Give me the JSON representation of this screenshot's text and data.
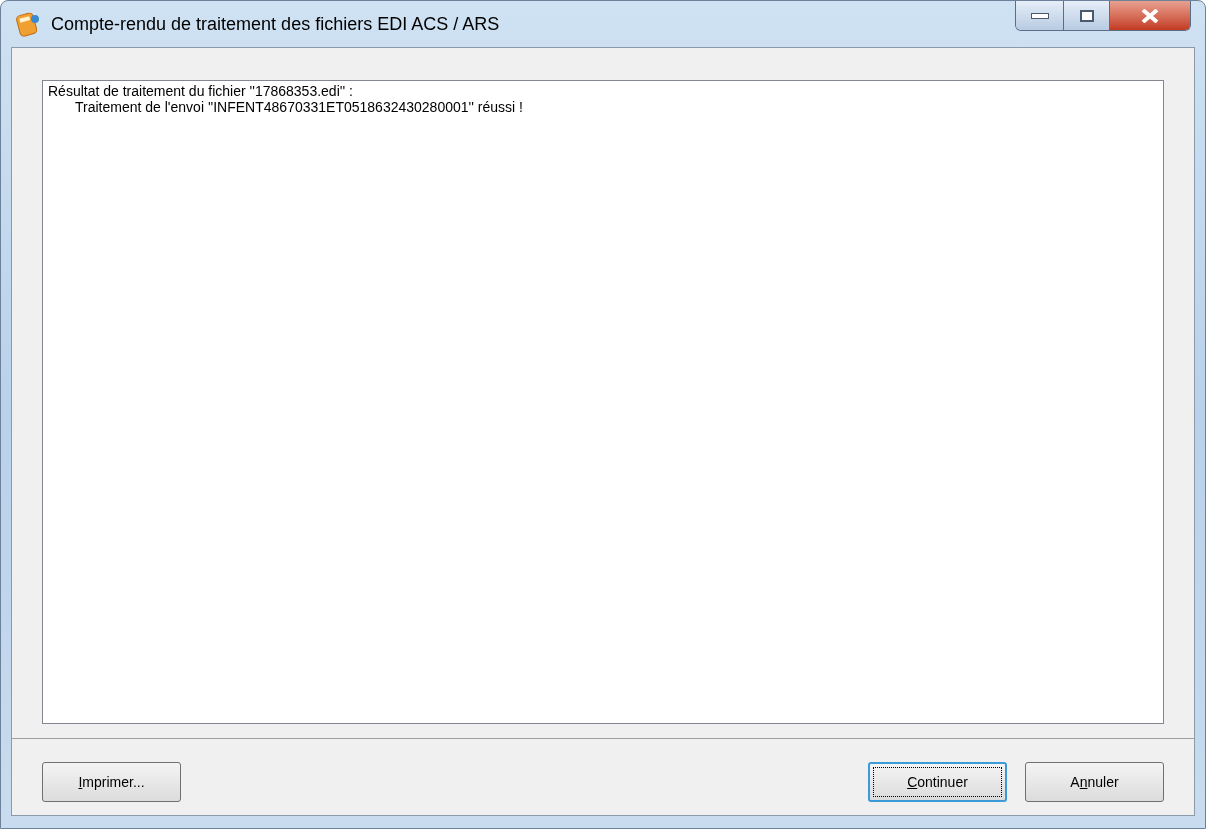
{
  "window": {
    "title": "Compte-rendu de traitement des fichiers EDI ACS / ARS"
  },
  "report": {
    "lines": [
      {
        "text": "Résultat de traitement du fichier ''17868353.edi'' :",
        "indent": false
      },
      {
        "text": "Traitement de l'envoi ''INFENT48670331ET0518632430280001'' réussi !",
        "indent": true
      }
    ]
  },
  "left_buttons": [
    {
      "access_key": "I",
      "after_key": "mprimer...",
      "default": false
    }
  ],
  "right_buttons": [
    {
      "access_key": "C",
      "after_key": "ontinuer",
      "default": true
    },
    {
      "before_key": "A",
      "access_key": "n",
      "after_key": "nuler",
      "default": false
    }
  ]
}
